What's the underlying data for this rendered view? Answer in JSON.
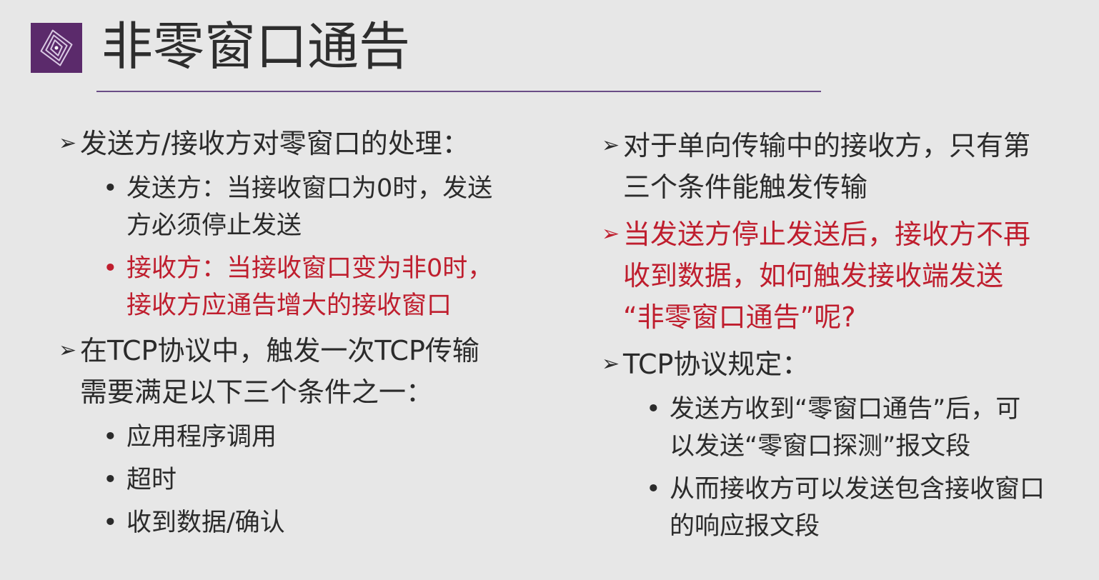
{
  "slide": {
    "title": "非零窗口通告",
    "colors": {
      "logo_bg": "#5b2a6b",
      "rule": "#6a4d86",
      "highlight": "#bf1e2e"
    },
    "icons": {
      "logo": "concentric-diamond-logo",
      "bullet_main": "arrowhead",
      "bullet_sub": "dot"
    },
    "left": {
      "point1": {
        "arrow": "➢",
        "line1": "发送方/接收方对零窗口的处理：",
        "subs": [
          {
            "dot": "•",
            "line1": "发送方：当接收窗口为0时，发送",
            "line2": "方必须停止发送"
          },
          {
            "dot": "•",
            "line1": "接收方：当接收窗口变为非0时，",
            "line2": "接收方应通告增大的接收窗口"
          }
        ]
      },
      "point2": {
        "arrow": "➢",
        "line1": "在TCP协议中，触发一次TCP传输",
        "line2": "需要满足以下三个条件之一：",
        "subs": [
          {
            "dot": "•",
            "text": "应用程序调用"
          },
          {
            "dot": "•",
            "text": "超时"
          },
          {
            "dot": "•",
            "text": "收到数据/确认"
          }
        ]
      }
    },
    "right": {
      "point1": {
        "arrow": "➢",
        "line1": "对于单向传输中的接收方，只有第",
        "line2": "三个条件能触发传输"
      },
      "point2": {
        "arrow": "➢",
        "line1": "当发送方停止发送后，接收方不再",
        "line2": "收到数据，如何触发接收端发送",
        "line3": "“非零窗口通告”呢?"
      },
      "point3": {
        "arrow": "➢",
        "line1": "TCP协议规定：",
        "subs": [
          {
            "dot": "•",
            "line1": "发送方收到“零窗口通告”后，可",
            "line2": "以发送“零窗口探测”报文段"
          },
          {
            "dot": "•",
            "line1": "从而接收方可以发送包含接收窗口",
            "line2": "的响应报文段"
          }
        ]
      }
    }
  }
}
